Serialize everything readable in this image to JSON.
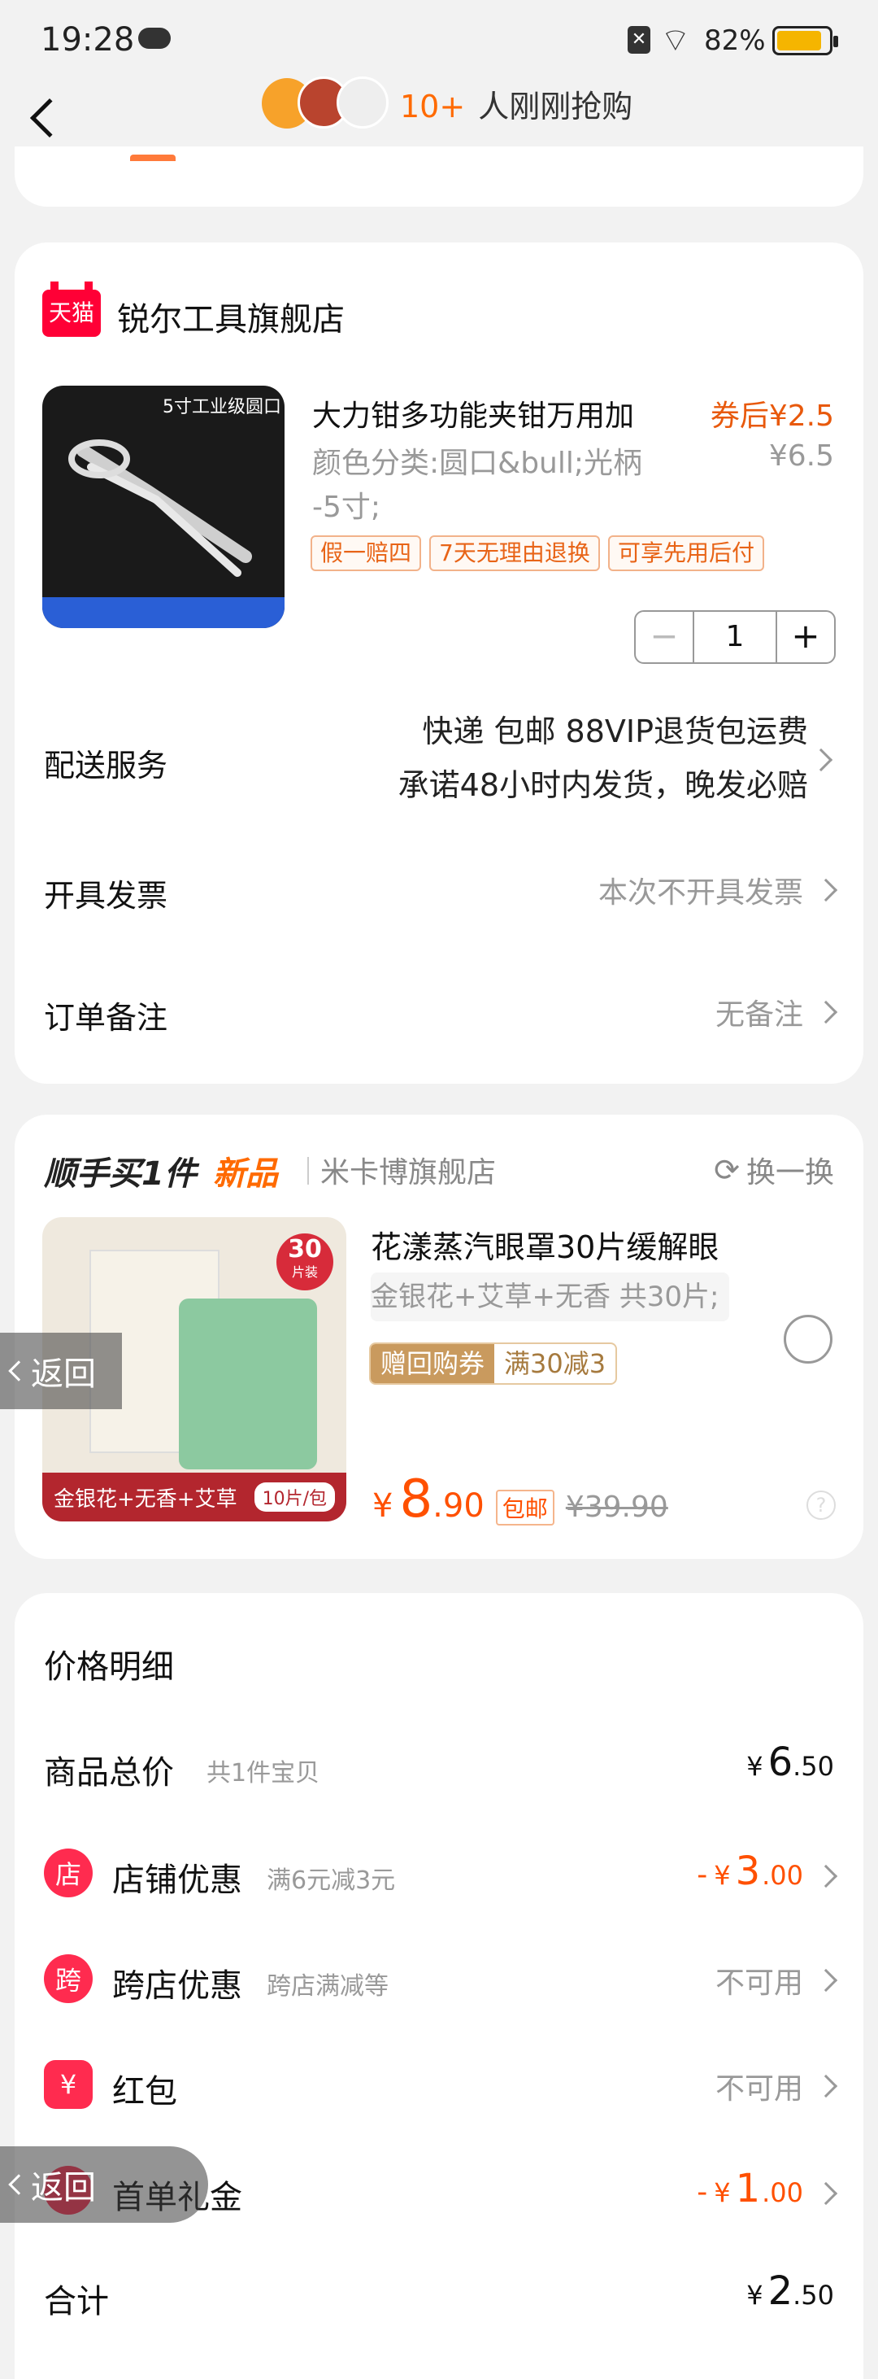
{
  "status_bar": {
    "time": "19:28",
    "battery": "82%"
  },
  "header": {
    "count": "10+",
    "text": "人刚刚抢购"
  },
  "store": {
    "badge": "天猫",
    "name": "锐尔工具旗舰店",
    "image_caption": "5寸工业级圆口",
    "product": {
      "title": "大力钳多功能夹钳万用加",
      "price_after_coupon": "券后¥2.5",
      "spec_line1": "颜色分类:圆口&bull;光柄",
      "spec_line2": "-5寸;",
      "original_price": "¥6.5",
      "tags": [
        "假一赔四",
        "7天无理由退换",
        "可享先用后付"
      ],
      "quantity": "1"
    },
    "delivery": {
      "label": "配送服务",
      "line1": "快递 包邮 88VIP退货包运费",
      "line2": "承诺48小时内发货，晚发必赔"
    },
    "invoice": {
      "label": "开具发票",
      "value": "本次不开具发票"
    },
    "note": {
      "label": "订单备注",
      "value": "无备注"
    }
  },
  "addon": {
    "title": "顺手买1件",
    "new_label": "新品",
    "shop": "米卡博旗舰店",
    "swap": "换一换",
    "product_title": "花漾蒸汽眼罩30片缓解眼",
    "spec": "金银花+艾草+无香 共30片;",
    "coupon_label": "赠回购券",
    "coupon_value": "满30减3",
    "image_caption": "金银花+无香+艾草",
    "image_pack": "10片/包",
    "image_badge_num": "30",
    "image_badge_unit": "片装",
    "price_symbol": "¥",
    "price_int": "8",
    "price_dec": ".90",
    "free_ship": "包邮",
    "orig_price": "¥39.90"
  },
  "price_detail": {
    "title": "价格明细",
    "total_label": "商品总价",
    "total_sub": "共1件宝贝",
    "total_sym": "¥",
    "total_int": "6",
    "total_dec": ".50",
    "shop_discount": {
      "icon": "店",
      "label": "店铺优惠",
      "sub": "满6元减3元",
      "sign": "-",
      "sym": "¥",
      "int": "3",
      "dec": ".00"
    },
    "cross_discount": {
      "icon": "跨",
      "label": "跨店优惠",
      "sub": "跨店满减等",
      "value": "不可用"
    },
    "red_packet": {
      "icon": "¥",
      "label": "红包",
      "value": "不可用"
    },
    "first_gift": {
      "label": "首单礼金",
      "sign": "-",
      "sym": "¥",
      "int": "1",
      "dec": ".00"
    },
    "sum_label": "合计",
    "sum_sym": "¥",
    "sum_int": "2",
    "sum_dec": ".50"
  },
  "back_label": "返回"
}
